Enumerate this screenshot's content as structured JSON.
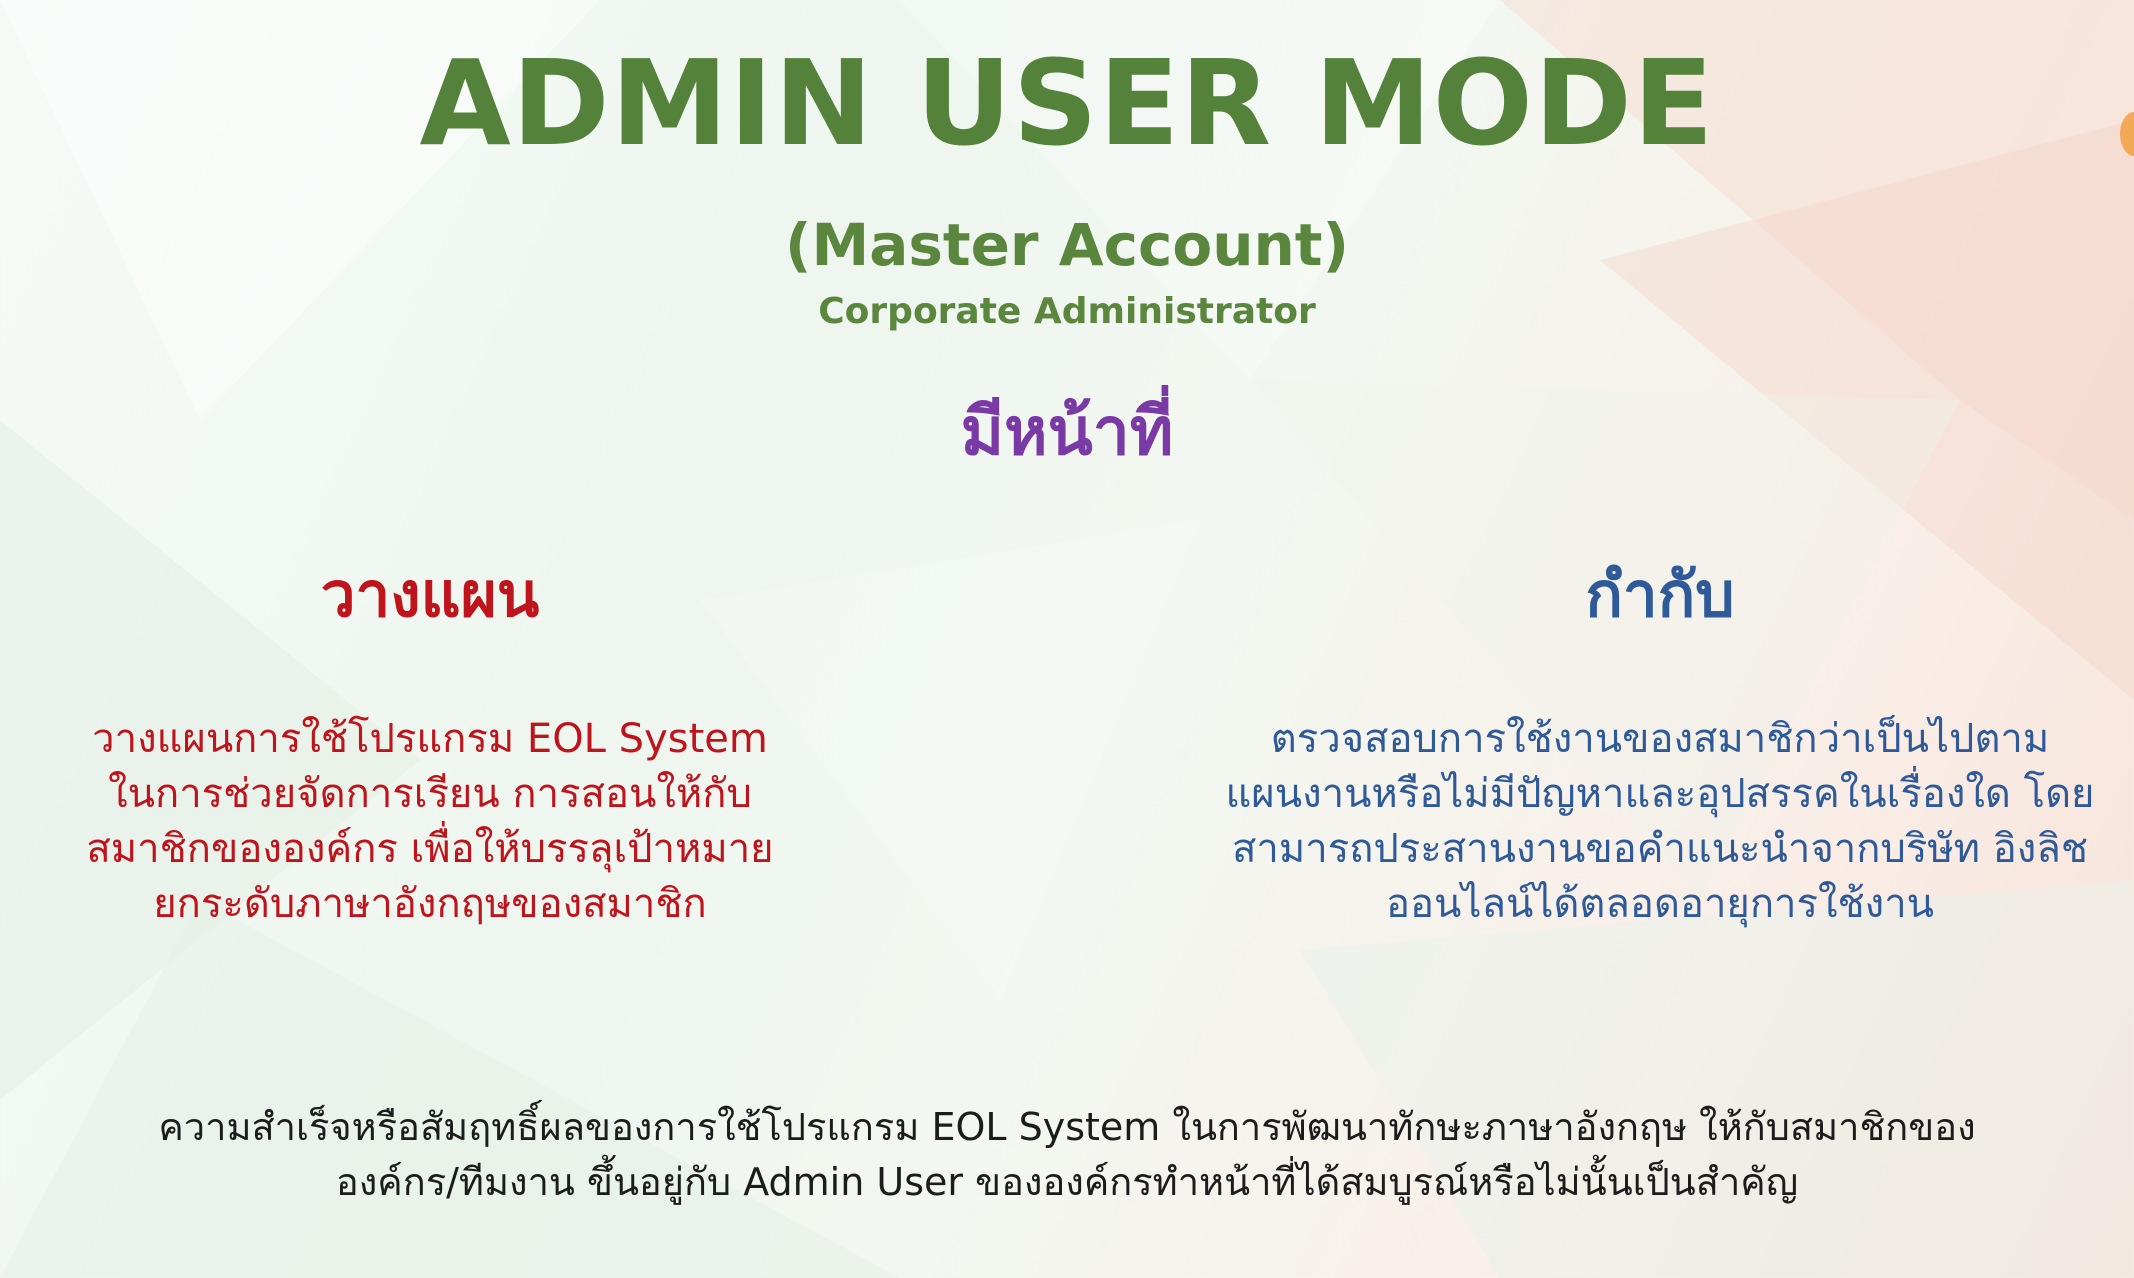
{
  "slide": {
    "title": "ADMIN USER MODE",
    "subtitle": "(Master Account)",
    "subtitle_small": "Corporate Administrator",
    "duty_heading": "มีหน้าที่"
  },
  "columns": {
    "plan": {
      "heading": "วางแผน",
      "lines": [
        "วางแผนการใช้โปรแกรม EOL System",
        "ในการช่วยจัดการเรียน การสอนให้กับ",
        "สมาชิกขององค์กร เพื่อให้บรรลุเป้าหมาย",
        "ยกระดับภาษาอังกฤษของสมาชิก"
      ]
    },
    "control": {
      "heading": "กำกับ",
      "lines": [
        "ตรวจสอบการใช้งานของสมาชิกว่าเป็นไปตาม",
        "แผนงานหรือไม่มีปัญหาและอุปสรรคในเรื่องใด โดย",
        "สามารถประสานงานขอคำแนะนำจากบริษัท อิงลิช",
        "ออนไลน์ได้ตลอดอายุการใช้งาน"
      ]
    }
  },
  "footer": {
    "lines": [
      "ความสำเร็จหรือสัมฤทธิ์ผลของการใช้โปรแกรม EOL System ในการพัฒนาทักษะภาษาอังกฤษ ให้กับสมาชิกของ",
      "องค์กร/ทีมงาน ขึ้นอยู่กับ Admin User ขององค์กรทำหน้าที่ได้สมบูรณ์หรือไม่นั้นเป็นสำคัญ"
    ]
  },
  "colors": {
    "title_green": "#55823a",
    "duty_purple": "#7a3aa6",
    "plan_red": "#c0141d",
    "control_blue": "#2f5a99",
    "footer_text": "#1c1c1c"
  }
}
